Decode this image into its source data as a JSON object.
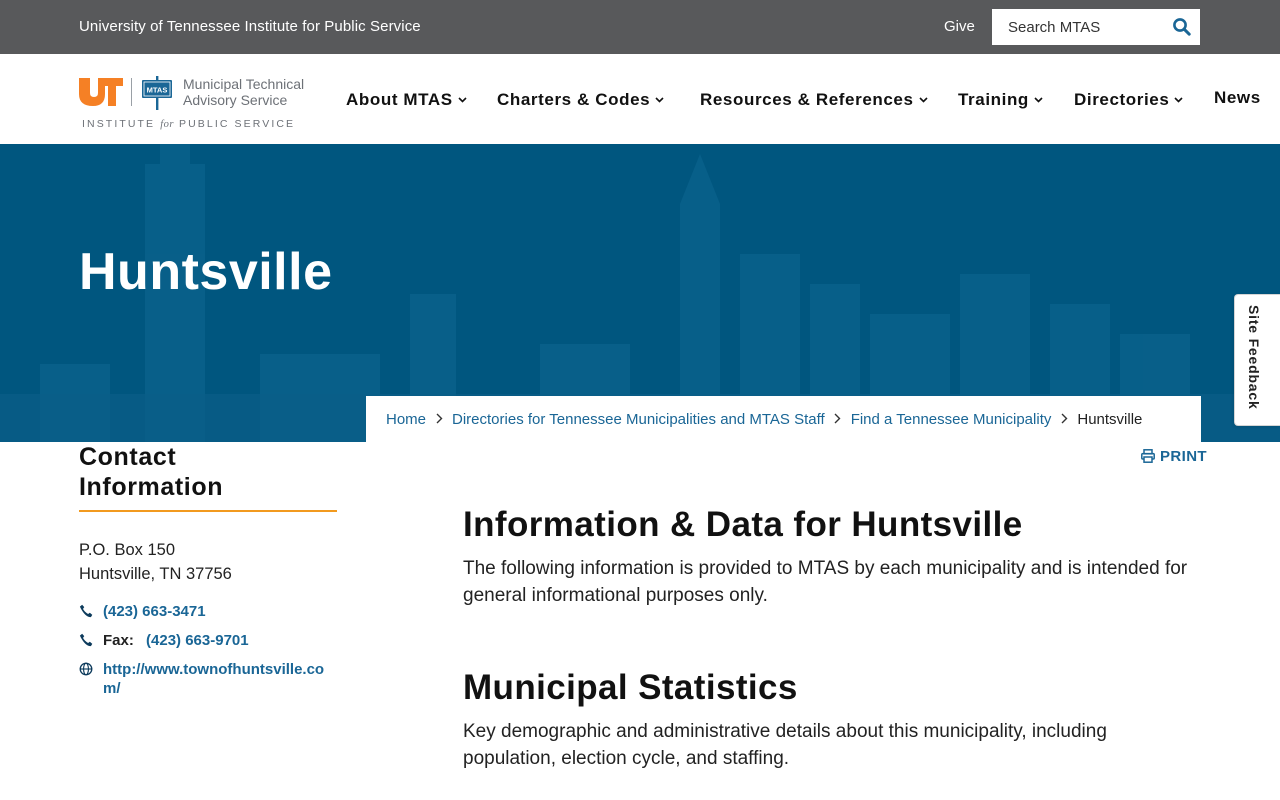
{
  "topbar": {
    "org_name": "University of Tennessee Institute for Public Service",
    "give_label": "Give",
    "search_placeholder": "Search MTAS"
  },
  "logo": {
    "ut_mark": "UT",
    "badge": "MTAS",
    "name_line1": "Municipal Technical",
    "name_line2": "Advisory Service",
    "tagline_pre": "INSTITUTE",
    "tagline_for": "for",
    "tagline_post": "PUBLIC SERVICE"
  },
  "nav": {
    "items": [
      {
        "label": "About MTAS",
        "has_dropdown": true
      },
      {
        "label": "Charters & Codes",
        "has_dropdown": true
      },
      {
        "label": "Resources & References",
        "has_dropdown": true
      },
      {
        "label": "Training",
        "has_dropdown": true
      },
      {
        "label": "Directories",
        "has_dropdown": true
      },
      {
        "label": "News",
        "has_dropdown": false
      }
    ]
  },
  "hero": {
    "title": "Huntsville"
  },
  "feedback": {
    "label": "Site Feedback"
  },
  "breadcrumb": {
    "items": [
      {
        "label": "Home"
      },
      {
        "label": "Directories for Tennessee Municipalities and MTAS Staff"
      },
      {
        "label": "Find a Tennessee Municipality"
      }
    ],
    "current": "Huntsville"
  },
  "contact": {
    "heading_line1": "Contact",
    "heading_line2": "Information",
    "address_line1": "P.O. Box 150",
    "address_line2": "Huntsville, TN 37756",
    "phone": "(423) 663-3471",
    "fax_label": "Fax:",
    "fax": "(423) 663-9701",
    "website": "http://www.townofhuntsville.com/"
  },
  "main": {
    "print_label": "PRINT",
    "section1_title": "Information & Data for Huntsville",
    "section1_text": "The following information is provided to MTAS by each municipality and is intended for general informational purposes only.",
    "section2_title": "Municipal Statistics",
    "section2_text": "Key demographic and administrative details about this municipality, including population, election cycle, and staffing."
  },
  "colors": {
    "topbar_bg": "#58595b",
    "hero_bg": "#00567f",
    "link": "#1a6696",
    "ut_orange": "#f58025",
    "accent_rule": "#f29a1f"
  }
}
